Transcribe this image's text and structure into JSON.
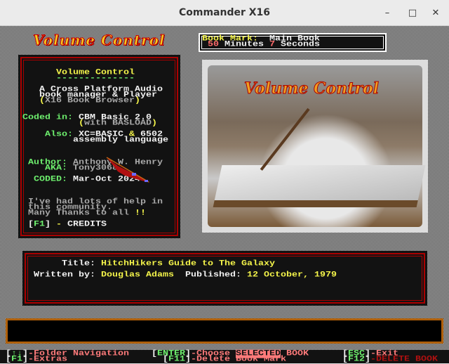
{
  "window": {
    "title": "Commander X16",
    "minimize": "–",
    "maximize": "□",
    "close": "✕"
  },
  "logo": "Volume Control",
  "bookmark": {
    "label": "Book Mark:",
    "name": "Main Book",
    "minutes": "50",
    "minutes_label": "Minutes",
    "seconds": "7",
    "seconds_label": "Seconds"
  },
  "about": {
    "title": "Volume Control",
    "underline": "--------------",
    "desc1": "A Cross Platform Audio",
    "desc2": "book manager & Player",
    "desc3_open": "(",
    "desc3": "X16 Book Browser",
    "desc3_close": ")",
    "coded_label": "Coded in:",
    "coded_value": "CBM Basic 2.0",
    "with_open": "(",
    "with": "with BASLOAD",
    "with_close": ")",
    "also_label": "Also:",
    "also_a": "XC=BASIC ",
    "also_amp": "&",
    "also_b": " 6502",
    "also2": "assembly language",
    "author_label": "Author:",
    "author": "Anthony W. Henry",
    "aka_label": "AKA:",
    "aka": "Tony3068",
    "codeddate_label": "CODED:",
    "codeddate": "Mar-Oct 2024",
    "thanks1": "I've had lots of help in",
    "thanks2": "this community.",
    "thanks3": "Many Thanks to all ",
    "thanks_bang": "!!",
    "credits_open": "[",
    "credits_key": "F1",
    "credits_close": "]",
    "credits_dash": " - ",
    "credits": "CREDITS"
  },
  "book": {
    "title_label": "Title:",
    "title": "HitchHikers Guide to The Galaxy",
    "author_label": "Written by:",
    "author": "Douglas Adams",
    "published_label": "Published:",
    "published": "12 October, 1979"
  },
  "image": {
    "logo": "Volume Control"
  },
  "footer": [
    {
      "key": "↑↓",
      "text": "-Folder Navigation"
    },
    {
      "key": "ENTER",
      "text": "-Choose ",
      "hl": "SELECTED",
      "text2": " BOOK"
    },
    {
      "key": "ESC",
      "text": "-Exit"
    },
    {
      "key": "F1",
      "text": "-Extras"
    },
    {
      "key": "F11",
      "text": "-Delete Book Mark"
    },
    {
      "key": "F12",
      "text": "-DELETE BOOK"
    }
  ],
  "colors": {
    "border_red": "#aa0000",
    "text_yellow": "#f4f44a",
    "text_green": "#6ef06e",
    "footer_salmon": "#ff7b7b",
    "bottom_border": "#b0600a"
  }
}
